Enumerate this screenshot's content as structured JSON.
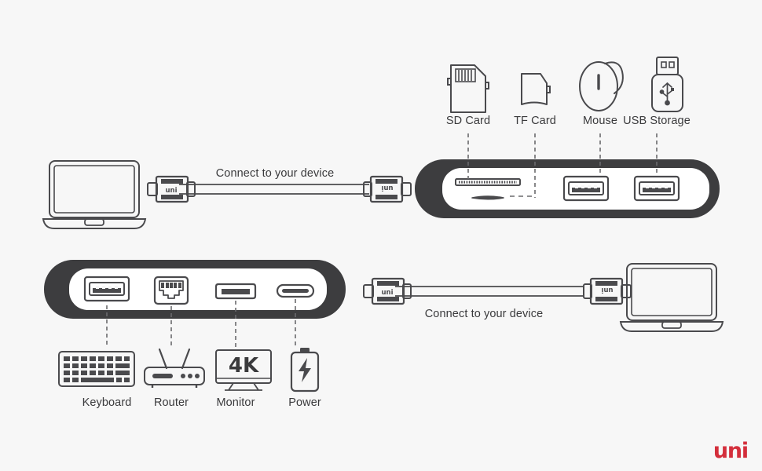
{
  "brand": {
    "logo_text": "uni",
    "logo_color": "#d42f3c"
  },
  "theme": {
    "background": "#f7f7f7",
    "stroke": "#4a4a4d",
    "shell": "#3d3d3f",
    "panel": "#ffffff",
    "text": "#3a3a3c"
  },
  "top_section": {
    "cable_caption": "Connect to your device",
    "left_device": "laptop",
    "connector_brand": "uni",
    "hub_ports": [
      {
        "name": "SD Card",
        "port_type": "sd-card-slot"
      },
      {
        "name": "TF Card",
        "port_type": "tf-card-slot"
      },
      {
        "name": "Mouse",
        "port_type": "usb-a"
      },
      {
        "name": "USB Storage",
        "port_type": "usb-a"
      }
    ],
    "device_labels": [
      "SD Card",
      "TF Card",
      "Mouse",
      "USB Storage"
    ]
  },
  "bottom_section": {
    "cable_caption": "Connect to your device",
    "right_device": "laptop",
    "connector_brand": "uni",
    "hub_ports": [
      {
        "name": "Keyboard",
        "port_type": "usb-a"
      },
      {
        "name": "Router",
        "port_type": "rj45-ethernet"
      },
      {
        "name": "Monitor",
        "port_type": "hdmi"
      },
      {
        "name": "Power",
        "port_type": "usb-c"
      }
    ],
    "device_labels": [
      "Keyboard",
      "Router",
      "Monitor",
      "Power"
    ],
    "monitor_badge": "4K"
  }
}
